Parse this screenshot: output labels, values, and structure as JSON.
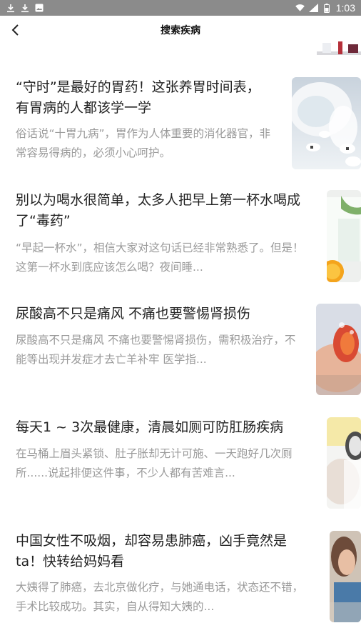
{
  "status_bar": {
    "time": "1:03"
  },
  "header": {
    "title": "搜索疾病"
  },
  "articles": [
    {
      "title": "“守时”是最好的胃药！这张养胃时间表， 有胃病的人都该学一学",
      "desc": "俗话说“十胃九病”，胃作为人体重要的消化器官，非常容易得病的，必须小心呵护。"
    },
    {
      "title": "别以为喝水很简单，太多人把早上第一杯水喝成了“毒药”",
      "desc": "“早起一杯水”，相信大家对这句话已经非常熟悉了。但是！这第一杯水到底应该怎么喝？夜间睡..."
    },
    {
      "title": "尿酸高不只是痛风 不痛也要警惕肾损伤",
      "desc": "尿酸高不只是痛风 不痛也要警惕肾损伤，需积极治疗，不能等出现并发症才去亡羊补牢 医学指..."
    },
    {
      "title": "每天1 ~ 3次最健康，清晨如厕可防肛肠疾病",
      "desc": "在马桶上眉头紧锁、肚子胀却无计可施、一天跑好几次厕所......说起排便这件事，不少人都有苦难言..."
    },
    {
      "title": "中国女性不吸烟，却容易患肺癌，凶手竟然是ta！快转给妈妈看",
      "desc": "大姨得了肺癌，去北京做化疗，与她通电话，状态还不错，手术比较成功。其实，自从得知大姨的..."
    }
  ]
}
